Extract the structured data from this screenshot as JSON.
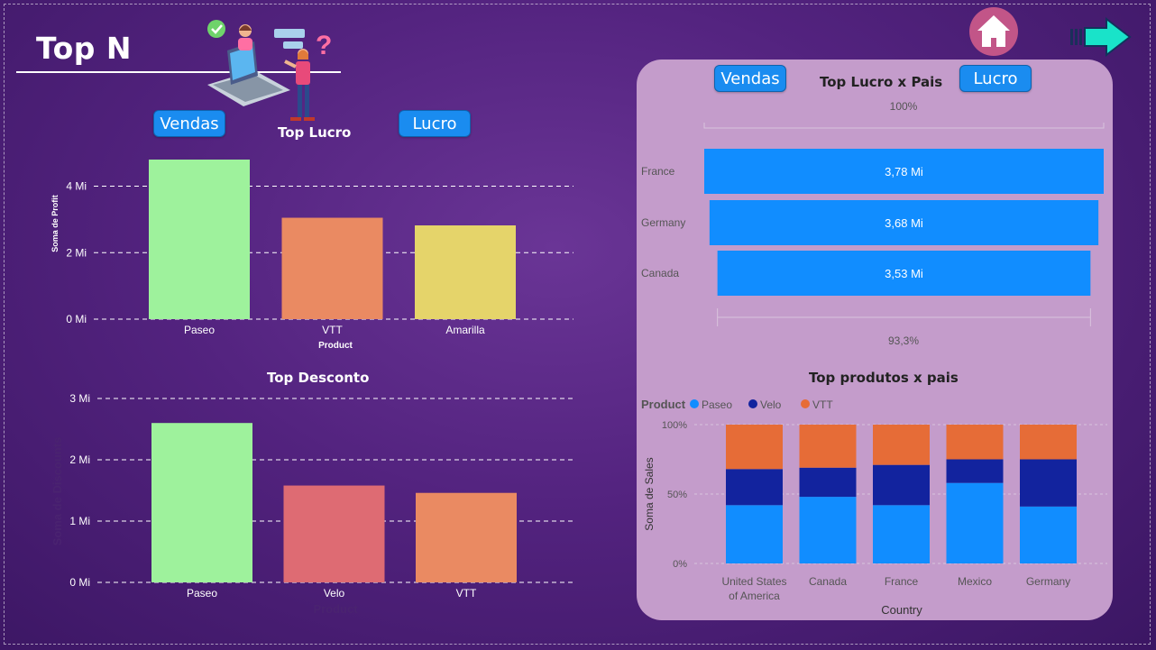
{
  "header": {
    "title": "Top N"
  },
  "buttons": {
    "vendas": "Vendas",
    "lucro": "Lucro"
  },
  "colors": {
    "green": "#9ef29c",
    "orange": "#ea8a62",
    "yellow": "#e5d46a",
    "red": "#de6b73",
    "blue": "#118dff",
    "navy": "#12239e",
    "vtt": "#e66c37"
  },
  "chart_data": [
    {
      "type": "bar",
      "title": "Top Lucro",
      "categories": [
        "Paseo",
        "VTT",
        "Amarilla"
      ],
      "values": [
        4.8,
        3.05,
        2.82
      ],
      "bar_colors": [
        "#9ef29c",
        "#ea8a62",
        "#e5d46a"
      ],
      "xlabel": "Product",
      "ylabel": "Soma de Profit",
      "ylim": [
        0,
        4.8
      ],
      "yticks": [
        0,
        2,
        4
      ],
      "ytick_labels": [
        "0 Mi",
        "2 Mi",
        "4 Mi"
      ],
      "grid": true
    },
    {
      "type": "bar",
      "title": "Top Desconto",
      "categories": [
        "Paseo",
        "Velo",
        "VTT"
      ],
      "values": [
        2.6,
        1.58,
        1.46
      ],
      "bar_colors": [
        "#9ef29c",
        "#de6b73",
        "#ea8a62"
      ],
      "xlabel": "Product",
      "ylabel": "Soma de Discounts",
      "ylim": [
        0,
        3
      ],
      "yticks": [
        0,
        1,
        2,
        3
      ],
      "ytick_labels": [
        "0 Mi",
        "1 Mi",
        "2 Mi",
        "3 Mi"
      ],
      "grid": true
    },
    {
      "type": "bar",
      "orientation": "horizontal",
      "title": "Top Lucro x Pais",
      "categories": [
        "France",
        "Germany",
        "Canada"
      ],
      "values": [
        3.78,
        3.68,
        3.53
      ],
      "data_labels": [
        "3,78 Mi",
        "3,68 Mi",
        "3,53 Mi"
      ],
      "top_label": "100%",
      "bottom_label": "93,3%",
      "bar_color": "#118dff"
    },
    {
      "type": "bar",
      "stacked": "percent",
      "title": "Top produtos x pais",
      "legend_title": "Product",
      "legend_position": "top-left",
      "categories": [
        "United States of America",
        "Canada",
        "France",
        "Mexico",
        "Germany"
      ],
      "category_lines": [
        [
          "United States",
          "of America"
        ],
        [
          "Canada"
        ],
        [
          "France"
        ],
        [
          "Mexico"
        ],
        [
          "Germany"
        ]
      ],
      "series": [
        {
          "name": "Paseo",
          "color": "#118dff",
          "values": [
            42,
            48,
            42,
            58,
            41
          ]
        },
        {
          "name": "Velo",
          "color": "#12239e",
          "values": [
            26,
            21,
            29,
            17,
            34
          ]
        },
        {
          "name": "VTT",
          "color": "#e66c37",
          "values": [
            32,
            31,
            29,
            25,
            25
          ]
        }
      ],
      "ytick_labels": [
        "0%",
        "50%",
        "100%"
      ],
      "xlabel": "Country",
      "ylabel": "Soma de Sales"
    }
  ]
}
